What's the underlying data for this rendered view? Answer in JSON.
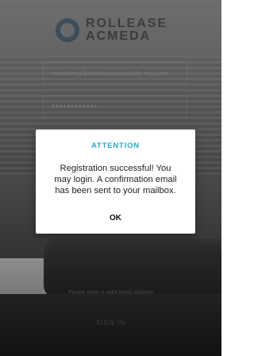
{
  "brand": {
    "name_line1": "ROLLEASE",
    "name_line2": "ACMEDA"
  },
  "login": {
    "email_value": "marketing@theshadespecialty.org.com",
    "password_value": "••••••••••••",
    "error_hint": "Please enter a valid email address",
    "signin_label": "SIGN IN"
  },
  "dialog": {
    "title": "ATTENTION",
    "message": "Registration successful! You\nmay login. A confirmation email\nhas been sent to your mailbox.",
    "ok_label": "OK"
  },
  "colors": {
    "dialog_title": "#23a9c9",
    "logo_ring": "#2d5f87"
  }
}
